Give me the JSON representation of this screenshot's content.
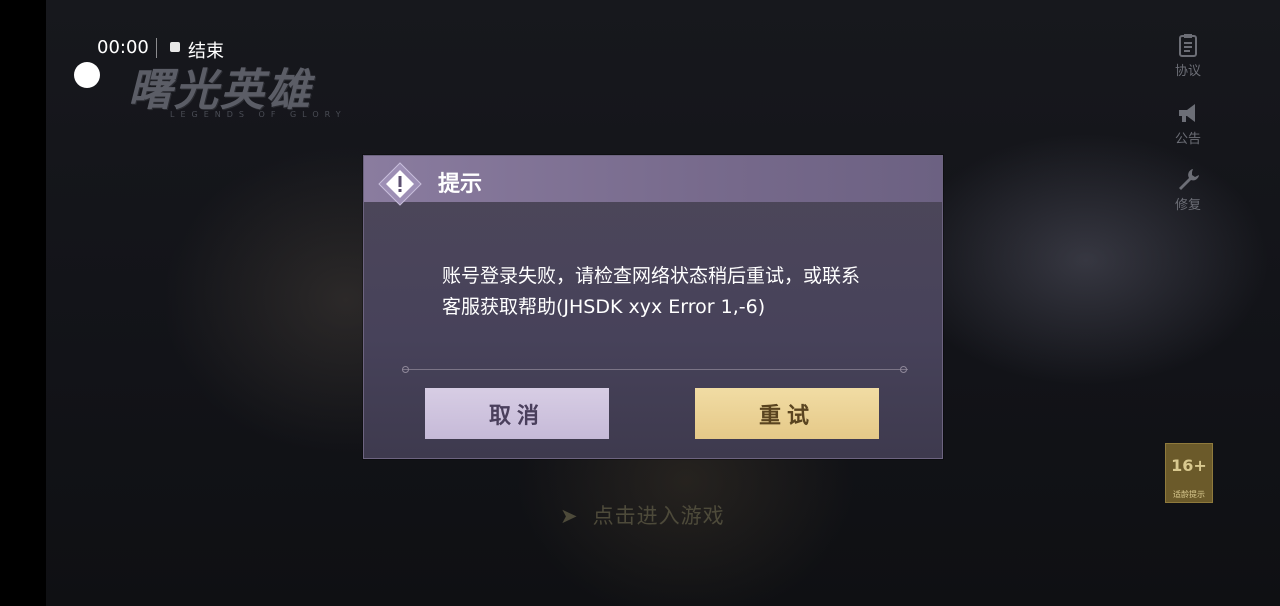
{
  "recorder": {
    "time": "00:00",
    "end_label": "结束"
  },
  "game": {
    "logo_text": "曙光英雄",
    "logo_sub": "LEGENDS OF GLORY"
  },
  "side_menu": {
    "items": [
      {
        "label": "协议",
        "icon": "clipboard-icon"
      },
      {
        "label": "公告",
        "icon": "megaphone-icon"
      },
      {
        "label": "修复",
        "icon": "wrench-icon"
      }
    ]
  },
  "age_rating": {
    "value": "16+",
    "label": "适龄提示"
  },
  "enter_game": {
    "label": "点击进入游戏"
  },
  "dialog": {
    "title": "提示",
    "message_line1": "账号登录失败，请检查网络状态稍后重试，或联系",
    "message_line2": "客服获取帮助(JHSDK xyx Error 1,-6)",
    "cancel_label": "取消",
    "retry_label": "重试"
  },
  "colors": {
    "dialog_header": "#8a7c9f",
    "dialog_body": "#4d4759",
    "cancel_button": "#d7cde4",
    "retry_button": "#f1dca4"
  }
}
